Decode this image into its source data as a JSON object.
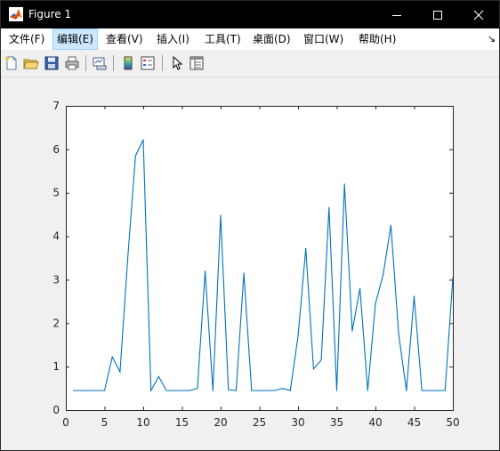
{
  "window": {
    "title": "Figure 1",
    "controls": {
      "minimize": "minimize",
      "maximize": "maximize",
      "close": "close"
    }
  },
  "menubar": {
    "items": [
      {
        "label": "文件(F)",
        "active": false
      },
      {
        "label": "编辑(E)",
        "active": true
      },
      {
        "label": "查看(V)",
        "active": false
      },
      {
        "label": "插入(I)",
        "active": false
      },
      {
        "label": "工具(T)",
        "active": false
      },
      {
        "label": "桌面(D)",
        "active": false
      },
      {
        "label": "窗口(W)",
        "active": false
      },
      {
        "label": "帮助(H)",
        "active": false
      }
    ],
    "expand_glyph": "↘"
  },
  "toolbar": {
    "buttons": [
      "new-figure-icon",
      "open-file-icon",
      "save-icon",
      "print-icon",
      "link-plot-icon",
      "colorbar-icon",
      "legend-icon",
      "edit-plot-arrow-icon",
      "property-inspector-icon"
    ]
  },
  "chart_data": {
    "type": "line",
    "title": "",
    "xlabel": "",
    "ylabel": "",
    "xlim": [
      0,
      50
    ],
    "ylim": [
      0,
      7
    ],
    "xticks": [
      0,
      5,
      10,
      15,
      20,
      25,
      30,
      35,
      40,
      45,
      50
    ],
    "yticks": [
      0,
      1,
      2,
      3,
      4,
      5,
      6,
      7
    ],
    "grid": false,
    "legend": null,
    "line_color": "#0072bd",
    "x": [
      1,
      2,
      3,
      4,
      5,
      6,
      7,
      8,
      9,
      10,
      11,
      12,
      13,
      14,
      15,
      16,
      17,
      18,
      19,
      20,
      21,
      22,
      23,
      24,
      25,
      26,
      27,
      28,
      29,
      30,
      31,
      32,
      33,
      34,
      35,
      36,
      37,
      38,
      39,
      40,
      41,
      42,
      43,
      44,
      45,
      46,
      47,
      48,
      49,
      50
    ],
    "values": [
      0.45,
      0.45,
      0.45,
      0.45,
      0.45,
      1.22,
      0.88,
      3.5,
      5.85,
      6.22,
      0.45,
      0.77,
      0.45,
      0.45,
      0.45,
      0.45,
      0.5,
      3.2,
      0.45,
      4.48,
      0.47,
      0.45,
      3.15,
      0.45,
      0.45,
      0.45,
      0.45,
      0.5,
      0.45,
      1.7,
      3.72,
      0.95,
      1.15,
      4.66,
      0.45,
      5.2,
      1.82,
      2.8,
      0.45,
      2.45,
      3.12,
      4.25,
      1.75,
      0.45,
      2.62,
      0.45,
      0.45,
      0.45,
      0.45,
      3.05
    ]
  }
}
